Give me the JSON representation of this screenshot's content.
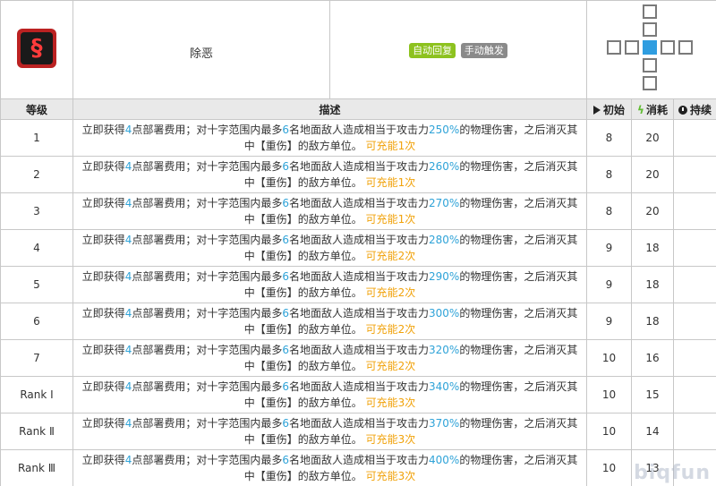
{
  "skill": {
    "name": "除恶",
    "icon": "skill-icon-crimson-glyph",
    "tags": [
      "自动回复",
      "手动触发"
    ]
  },
  "columns": {
    "level": "等级",
    "description": "描述",
    "initial": "初始",
    "cost": "消耗",
    "duration": "持续"
  },
  "levels": [
    {
      "level": "1",
      "sp": "4",
      "targets": "6",
      "atk": "250%",
      "charges": "可充能1次",
      "initial": "8",
      "cost": "20",
      "duration": ""
    },
    {
      "level": "2",
      "sp": "4",
      "targets": "6",
      "atk": "260%",
      "charges": "可充能1次",
      "initial": "8",
      "cost": "20",
      "duration": ""
    },
    {
      "level": "3",
      "sp": "4",
      "targets": "6",
      "atk": "270%",
      "charges": "可充能1次",
      "initial": "8",
      "cost": "20",
      "duration": ""
    },
    {
      "level": "4",
      "sp": "4",
      "targets": "6",
      "atk": "280%",
      "charges": "可充能2次",
      "initial": "9",
      "cost": "18",
      "duration": ""
    },
    {
      "level": "5",
      "sp": "4",
      "targets": "6",
      "atk": "290%",
      "charges": "可充能2次",
      "initial": "9",
      "cost": "18",
      "duration": ""
    },
    {
      "level": "6",
      "sp": "4",
      "targets": "6",
      "atk": "300%",
      "charges": "可充能2次",
      "initial": "9",
      "cost": "18",
      "duration": ""
    },
    {
      "level": "7",
      "sp": "4",
      "targets": "6",
      "atk": "320%",
      "charges": "可充能2次",
      "initial": "10",
      "cost": "16",
      "duration": ""
    },
    {
      "level": "Rank Ⅰ",
      "sp": "4",
      "targets": "6",
      "atk": "340%",
      "charges": "可充能3次",
      "initial": "10",
      "cost": "15",
      "duration": ""
    },
    {
      "level": "Rank Ⅱ",
      "sp": "4",
      "targets": "6",
      "atk": "370%",
      "charges": "可充能3次",
      "initial": "10",
      "cost": "14",
      "duration": ""
    },
    {
      "level": "Rank Ⅲ",
      "sp": "4",
      "targets": "6",
      "atk": "400%",
      "charges": "可充能3次",
      "initial": "10",
      "cost": "13",
      "duration": ""
    }
  ],
  "desc_parts": {
    "p1": "立即获得",
    "p2": "点部署费用；对十字范围内最多",
    "p3": "名地面敌人造成相当于攻击力",
    "p4": "的物理伤害，之后消灭其中【重伤】的敌方单位。"
  },
  "watermark": "biqfun"
}
